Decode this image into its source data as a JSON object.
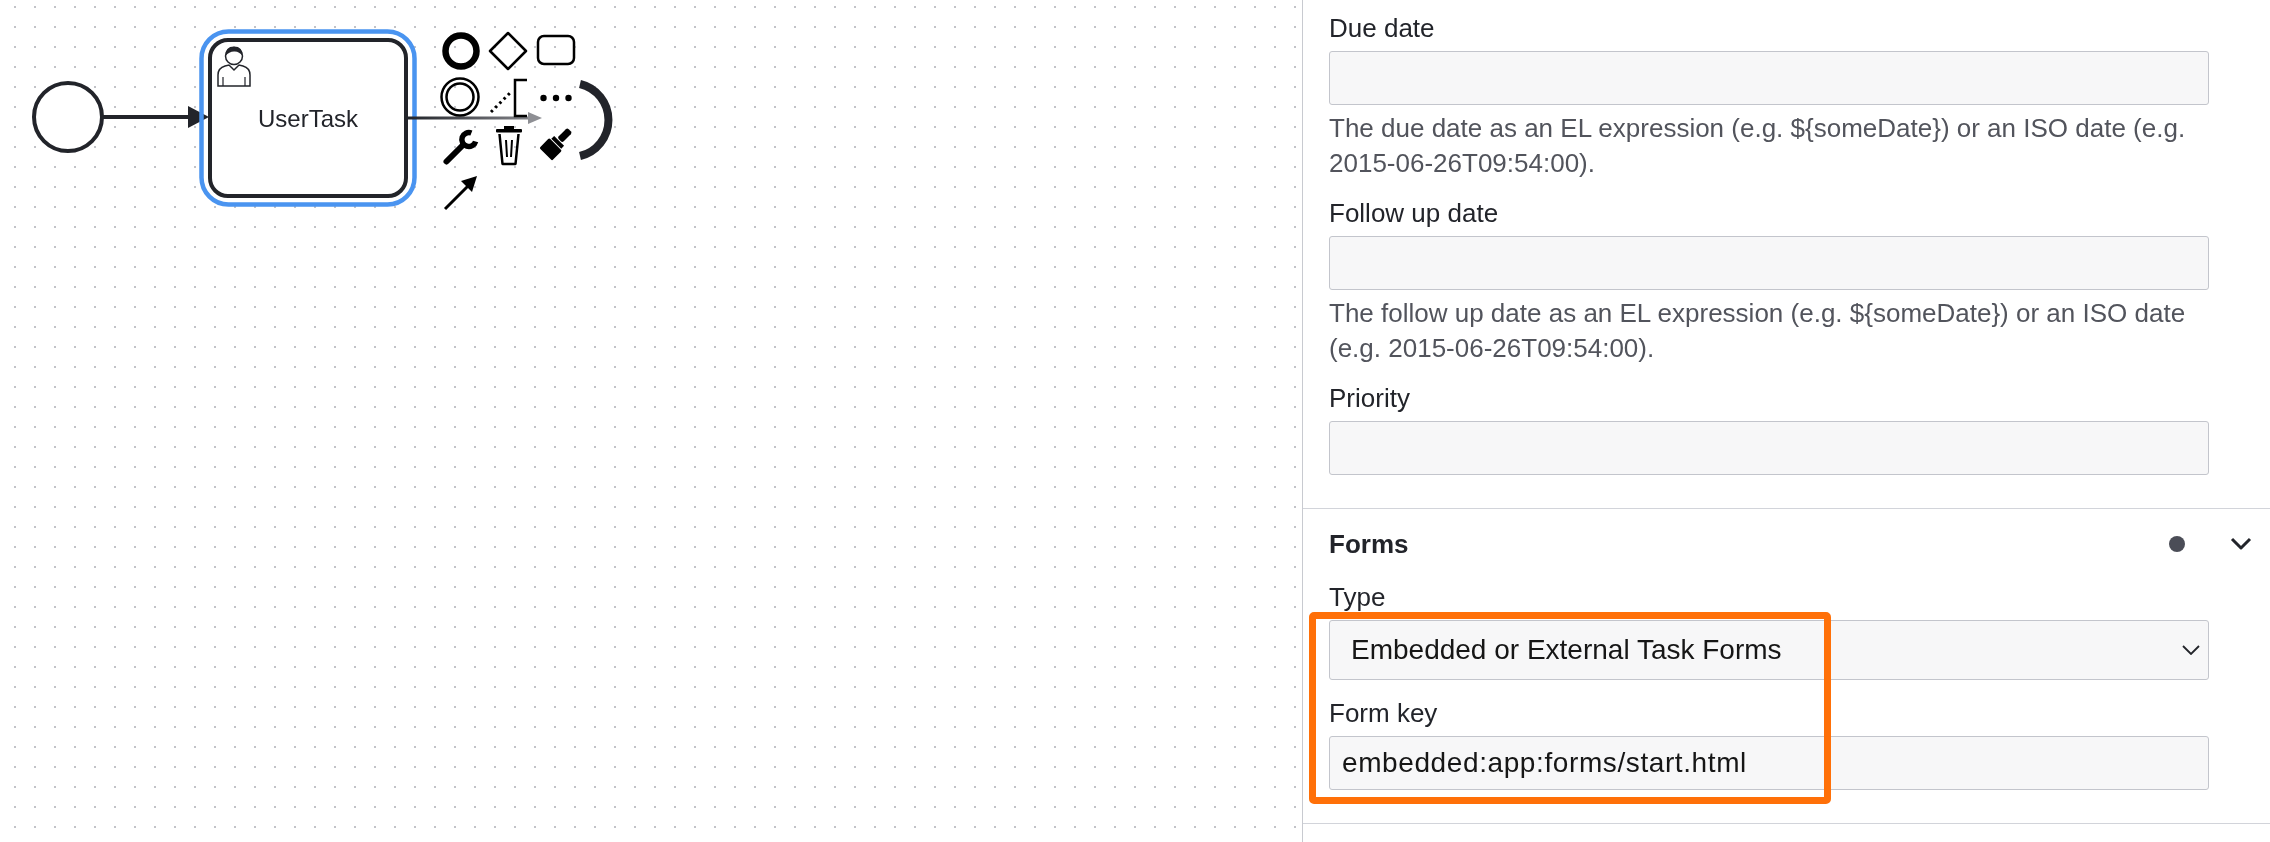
{
  "diagram": {
    "task": {
      "label": "UserTask",
      "selected": true
    }
  },
  "properties_panel": {
    "groups": [
      {
        "entries": [
          {
            "kind": "text",
            "label": "Due date",
            "description": "The due date as an EL expression (e.g. ${someDate}) or an ISO date (e.g. 2015-06-26T09:54:00).",
            "highlighted": false
          },
          {
            "kind": "text",
            "label": "Follow up date",
            "description": "The follow up date as an EL expression (e.g. ${someDate}) or an ISO date (e.g. 2015-06-26T09:54:00).",
            "highlighted": false
          },
          {
            "kind": "text",
            "label": "Priority",
            "highlighted": false
          }
        ]
      },
      {
        "title": "Forms",
        "has_data": true,
        "expanded": true,
        "entries": [
          {
            "kind": "select",
            "label": "Type",
            "value": "Embedded or External Task Forms",
            "highlighted": true
          },
          {
            "kind": "text",
            "label": "Form key",
            "value": "embedded:app:forms/start.html",
            "highlighted": true
          }
        ]
      }
    ]
  }
}
